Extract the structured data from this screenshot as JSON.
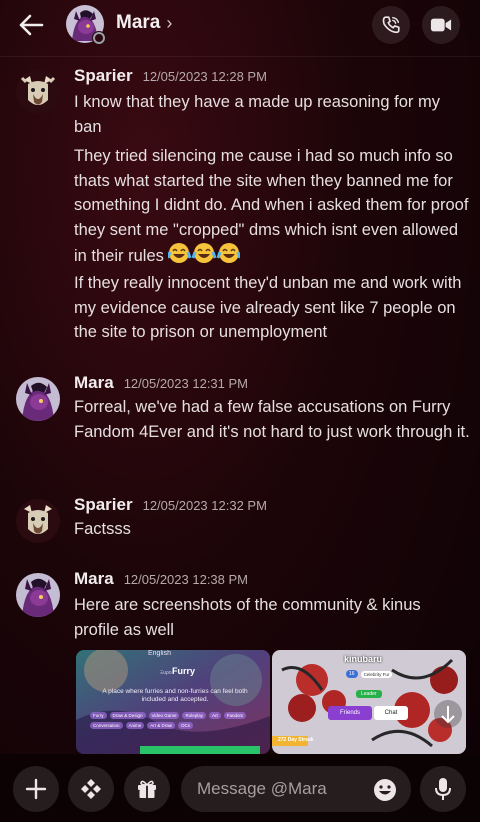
{
  "header": {
    "title": "Mara",
    "chevron": "›"
  },
  "messages": [
    {
      "author": "Sparier",
      "time": "12/05/2023 12:28 PM",
      "paragraphs": [
        "I know that they have a made up reasoning for my ban",
        "They tried silencing me cause i had so much info so thats what started the site when they banned me for something I didnt do. And when i asked them for proof they sent me \"cropped\" dms which isnt even allowed in their rules",
        "If they really innocent they'd unban me and work with my evidence cause ive already sent like 7 people on the site to prison or unemployment"
      ],
      "emoji_run": [
        "😂",
        "😂",
        "😂"
      ]
    },
    {
      "author": "Mara",
      "time": "12/05/2023 12:31 PM",
      "paragraphs": [
        "Forreal, we've had a few false accusations on Furry Fandom 4Ever and it's not hard to just work through it."
      ]
    },
    {
      "author": "Sparier",
      "time": "12/05/2023 12:32 PM",
      "paragraphs": [
        "Factsss"
      ]
    },
    {
      "author": "Mara",
      "time": "12/05/2023 12:38 PM",
      "paragraphs": [
        "Here are screenshots of the community & kinus profile as well"
      ]
    }
  ],
  "attachments": {
    "community": {
      "language": "English",
      "name": "Furry",
      "name_prefix": "Ξυρο",
      "description": "A place where furries and non-furries can feel both included and accepted.",
      "tags": [
        "Furry",
        "Draw & Design",
        "Video Game",
        "Roleplay",
        "Art",
        "Fandom",
        "Conversation",
        "Anime",
        "Art & Draw",
        "OCs"
      ]
    },
    "profile": {
      "username": "kinubaru",
      "level": "16",
      "title": "Celebrity Fur",
      "role": "Leader",
      "friends_label": "Friends",
      "chat_label": "Chat",
      "streak": "272 Day Streak"
    }
  },
  "composer": {
    "placeholder": "Message @Mara"
  },
  "colors": {
    "background": "#1c0509",
    "accent_purple": "#8a3fd1",
    "leader_green": "#27b04a"
  }
}
